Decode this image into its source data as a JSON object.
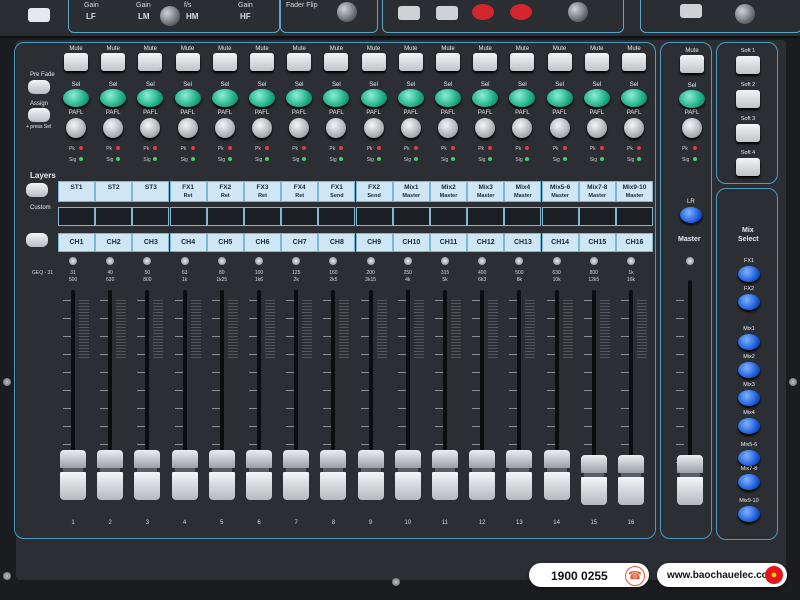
{
  "top_labels": {
    "gain_lf": "Gain",
    "lf": "LF",
    "gain_lm": "Gain",
    "lm": "LM",
    "hm": "HM",
    "gain_hf": "Gain",
    "hf": "HF",
    "hm_prefix": "f/s",
    "fader_flip": "Fader Flip"
  },
  "strip_labels": {
    "mute": "Mute",
    "sel": "Sel",
    "pafl": "PAFL",
    "pk": "Pk",
    "sig": "Sig"
  },
  "left_controls": {
    "pre_fade": "Pre Fade",
    "assign": "Assign",
    "press_sel": "+ press Sel",
    "layers": "Layers",
    "custom": "Custom"
  },
  "fx_names": [
    {
      "l1": "ST1",
      "l2": ""
    },
    {
      "l1": "ST2",
      "l2": ""
    },
    {
      "l1": "ST3",
      "l2": ""
    },
    {
      "l1": "FX1",
      "l2": "Ret"
    },
    {
      "l1": "FX2",
      "l2": "Ret"
    },
    {
      "l1": "FX3",
      "l2": "Ret"
    },
    {
      "l1": "FX4",
      "l2": "Ret"
    },
    {
      "l1": "FX1",
      "l2": "Send"
    },
    {
      "l1": "FX2",
      "l2": "Send"
    },
    {
      "l1": "Mix1",
      "l2": "Master"
    },
    {
      "l1": "Mix2",
      "l2": "Master"
    },
    {
      "l1": "Mix3",
      "l2": "Master"
    },
    {
      "l1": "Mix4",
      "l2": "Master"
    },
    {
      "l1": "Mix5-6",
      "l2": "Master"
    },
    {
      "l1": "Mix7-8",
      "l2": "Master"
    },
    {
      "l1": "Mix9-10",
      "l2": "Master"
    }
  ],
  "channels": [
    "CH1",
    "CH2",
    "CH3",
    "CH4",
    "CH5",
    "CH6",
    "CH7",
    "CH8",
    "CH9",
    "CH10",
    "CH11",
    "CH12",
    "CH13",
    "CH14",
    "CH15",
    "CH16"
  ],
  "geq_label": "GEQ - 31",
  "freq_scale": [
    {
      "a": "31",
      "b": "500"
    },
    {
      "a": "40",
      "b": "630"
    },
    {
      "a": "50",
      "b": "800"
    },
    {
      "a": "63",
      "b": "1k"
    },
    {
      "a": "80",
      "b": "1k25"
    },
    {
      "a": "100",
      "b": "1k6"
    },
    {
      "a": "125",
      "b": "2k"
    },
    {
      "a": "160",
      "b": "2k5"
    },
    {
      "a": "200",
      "b": "3k15"
    },
    {
      "a": "250",
      "b": "4k"
    },
    {
      "a": "315",
      "b": "5k"
    },
    {
      "a": "400",
      "b": "6k3"
    },
    {
      "a": "500",
      "b": "8k"
    },
    {
      "a": "630",
      "b": "10k"
    },
    {
      "a": "800",
      "b": "12k5"
    },
    {
      "a": "1k",
      "b": "16k"
    }
  ],
  "fader_numbers": [
    "1",
    "2",
    "3",
    "4",
    "5",
    "6",
    "7",
    "8",
    "9",
    "10",
    "11",
    "12",
    "13",
    "14",
    "15",
    "16"
  ],
  "master": {
    "mute": "Mute",
    "sel": "Sel",
    "pafl": "PAFL",
    "lr": "LR",
    "label": "Master"
  },
  "softkeys": [
    "Soft 1",
    "Soft 2",
    "Soft 3",
    "Soft 4"
  ],
  "mix_select": {
    "title_1": "Mix",
    "title_2": "Select",
    "buttons": [
      "FX1",
      "FX2",
      "Mix1",
      "Mix2",
      "Mix3",
      "Mix4",
      "Mix5-6",
      "Mix7-8",
      "Mix9-10"
    ]
  },
  "contact": {
    "phone": "1900 0255",
    "website": "www.baochauelec.com"
  },
  "colors": {
    "accent_blue": "#4c9cc4",
    "lcd": "#cfe7f4",
    "sel_green": "#1fae86",
    "mix_blue": "#1656d8",
    "pfl_red": "#d2262c"
  }
}
